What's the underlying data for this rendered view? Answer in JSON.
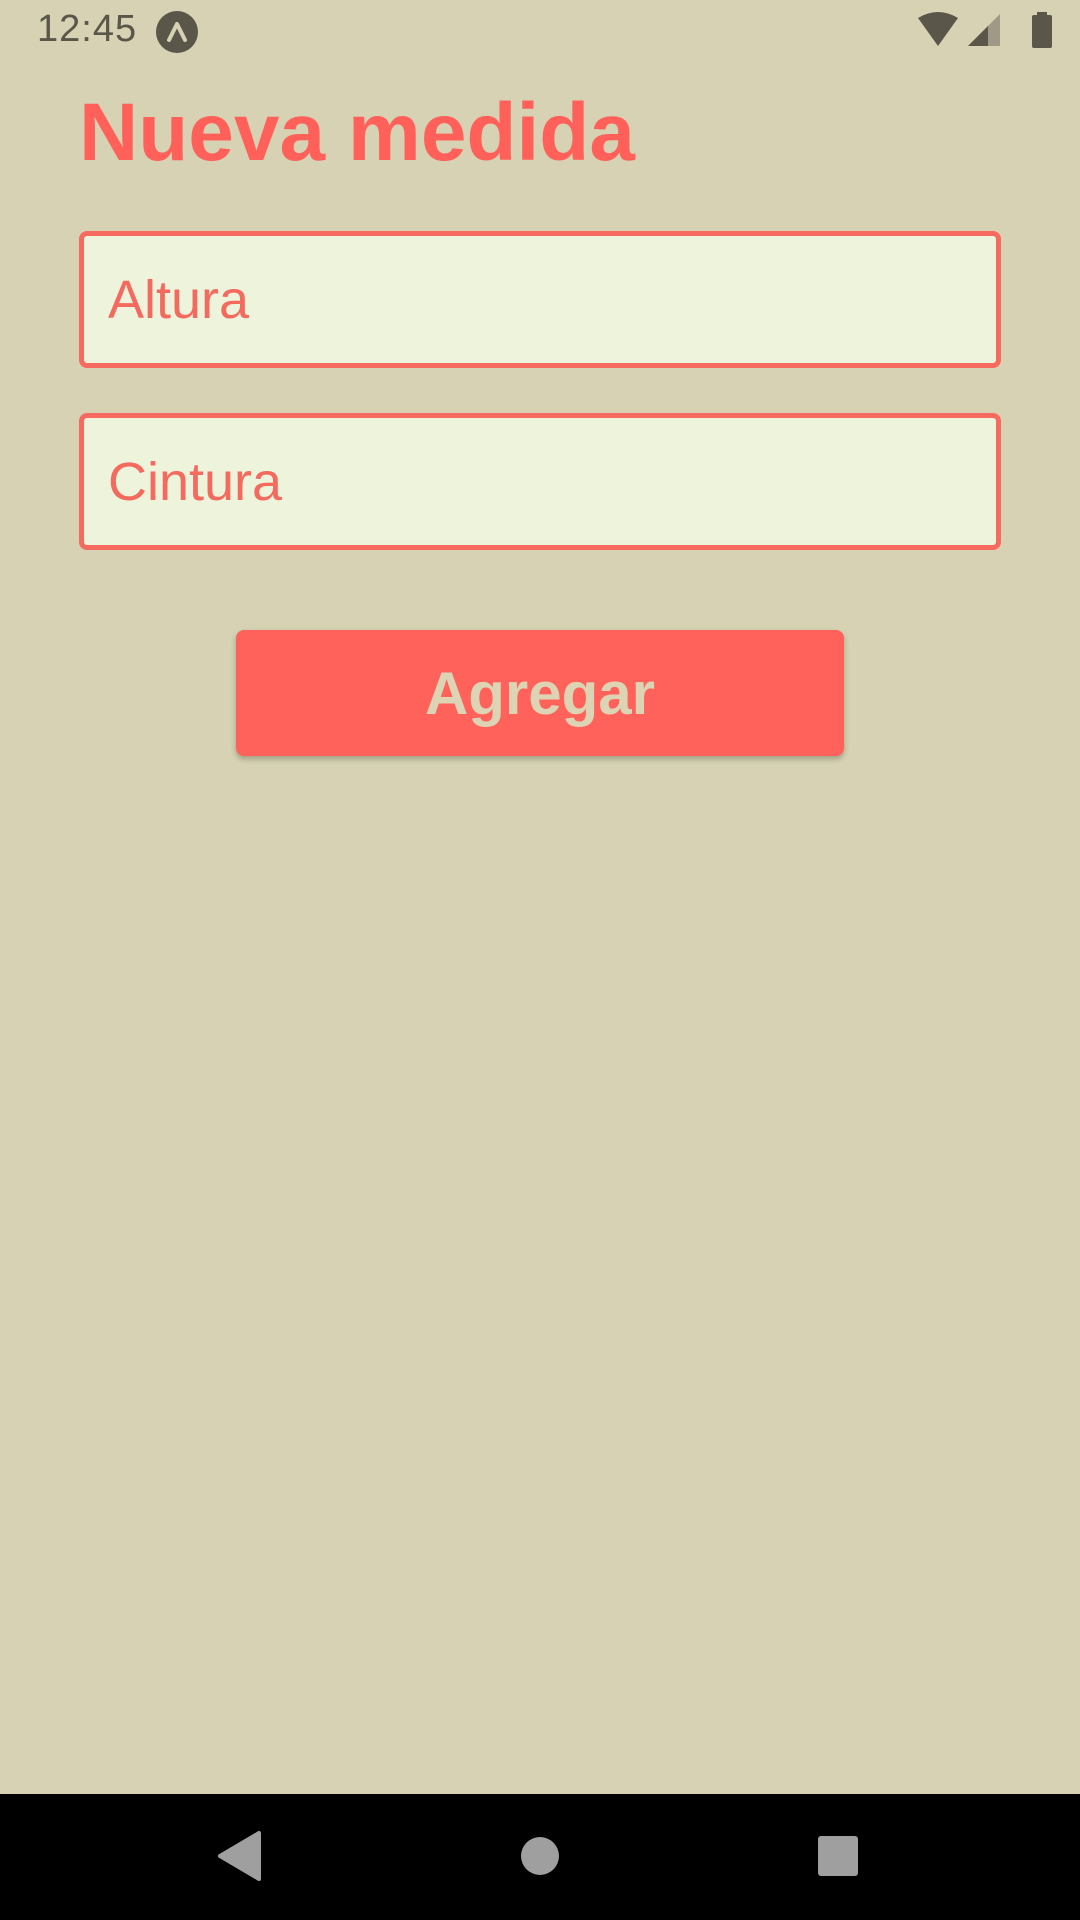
{
  "status_bar": {
    "time": "12:45",
    "icons": [
      "expo-icon",
      "wifi-icon",
      "signal-icon",
      "battery-icon"
    ]
  },
  "form": {
    "title": "Nueva medida",
    "height_placeholder": "Altura",
    "height_value": "",
    "waist_placeholder": "Cintura",
    "waist_value": "",
    "submit_label": "Agregar"
  },
  "nav_bar": {
    "icons": [
      "back-icon",
      "home-icon",
      "recents-icon"
    ]
  },
  "colors": {
    "background": "#d6d2b3",
    "accent": "#ff615a",
    "input_background": "#eef4dc",
    "button_text": "#dcd4b4",
    "status_icons": "#5a574a",
    "nav_bar": "#000000"
  }
}
